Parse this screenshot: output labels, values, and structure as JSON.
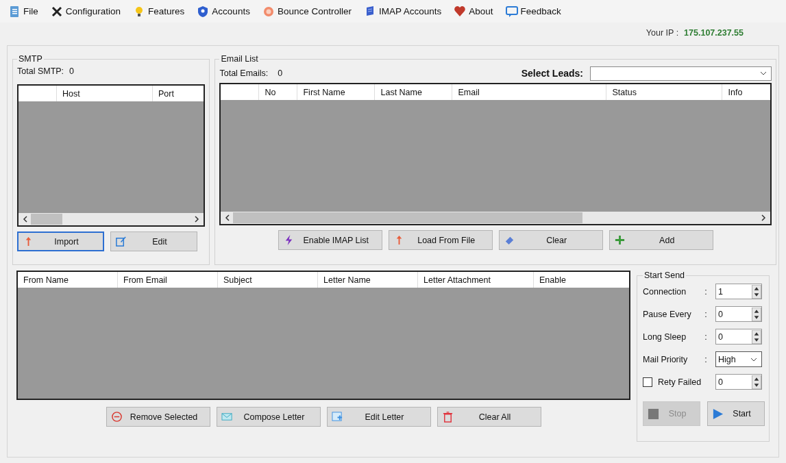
{
  "menu": [
    {
      "label": "File"
    },
    {
      "label": "Configuration"
    },
    {
      "label": "Features"
    },
    {
      "label": "Accounts"
    },
    {
      "label": "Bounce Controller"
    },
    {
      "label": "IMAP Accounts"
    },
    {
      "label": "About"
    },
    {
      "label": "Feedback"
    }
  ],
  "ip": {
    "label": "Your IP :",
    "value": "175.107.237.55"
  },
  "smtp": {
    "title": "SMTP",
    "total_label": "Total SMTP:",
    "total": "0",
    "columns": [
      "",
      "Host",
      "Port"
    ],
    "buttons": [
      {
        "label": "Import",
        "focused": true
      },
      {
        "label": "Edit",
        "focused": false
      }
    ]
  },
  "email_list": {
    "title": "Email List",
    "total_label": "Total Emails:",
    "total": "0",
    "select_label": "Select Leads:",
    "columns": [
      "",
      "No",
      "First Name",
      "Last Name",
      "Email",
      "Status",
      "Info"
    ],
    "buttons": [
      {
        "label": "Enable IMAP List"
      },
      {
        "label": "Load From File"
      },
      {
        "label": "Clear"
      },
      {
        "label": "Add"
      }
    ]
  },
  "letters": {
    "columns": [
      "From Name",
      "From Email",
      "Subject",
      "Letter Name",
      "Letter Attachment",
      "Enable"
    ],
    "buttons": [
      {
        "label": "Remove Selected"
      },
      {
        "label": "Compose Letter"
      },
      {
        "label": "Edit Letter"
      },
      {
        "label": "Clear All"
      }
    ]
  },
  "start_send": {
    "title": "Start Send",
    "settings": [
      {
        "kind": "spin",
        "label": "Connection",
        "colon": ":",
        "value": "1"
      },
      {
        "kind": "spin",
        "label": "Pause Every",
        "colon": ":",
        "value": "0"
      },
      {
        "kind": "spin",
        "label": "Long Sleep",
        "colon": ":",
        "value": "0"
      },
      {
        "kind": "select",
        "label": "Mail Priority",
        "colon": ":",
        "value": "High"
      },
      {
        "kind": "checkspin",
        "label": "Rety Failed",
        "checked": false,
        "value": "0"
      }
    ],
    "buttons": [
      {
        "label": "Stop",
        "disabled": true
      },
      {
        "label": "Start",
        "disabled": false
      }
    ]
  }
}
